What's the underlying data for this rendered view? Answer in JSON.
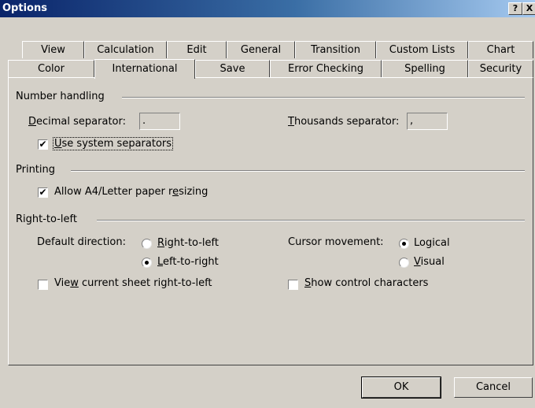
{
  "window": {
    "title": "Options",
    "help_label": "?",
    "close_label": "X"
  },
  "tabs_row1": [
    {
      "label": "View"
    },
    {
      "label": "Calculation"
    },
    {
      "label": "Edit"
    },
    {
      "label": "General"
    },
    {
      "label": "Transition"
    },
    {
      "label": "Custom Lists"
    },
    {
      "label": "Chart"
    }
  ],
  "tabs_row2": [
    {
      "label": "Color"
    },
    {
      "label": "International"
    },
    {
      "label": "Save"
    },
    {
      "label": "Error Checking"
    },
    {
      "label": "Spelling"
    },
    {
      "label": "Security"
    }
  ],
  "active_tab": "International",
  "number_handling": {
    "title": "Number handling",
    "decimal_label_u": "D",
    "decimal_label_rest": "ecimal separator:",
    "decimal_value": ".",
    "thousands_label_u": "T",
    "thousands_label_rest": "housands separator:",
    "thousands_value": ",",
    "use_system_u": "U",
    "use_system_rest": "se system separators",
    "use_system_checked": "✔"
  },
  "printing": {
    "title": "Printing",
    "a4_pre": "Allow A4/Letter paper r",
    "a4_u": "e",
    "a4_post": "sizing",
    "a4_checked": "✔"
  },
  "rtl": {
    "title": "Right-to-left",
    "default_direction_label": "Default direction:",
    "rtl_option_u": "R",
    "rtl_option_rest": "ight-to-left",
    "ltr_option_u": "L",
    "ltr_option_rest": "eft-to-right",
    "cursor_label": "Cursor movement:",
    "logical_pre": "Lo",
    "logical_u": "g",
    "logical_post": "ical",
    "visual_u": "V",
    "visual_rest": "isual",
    "view_sheet_pre": "Vie",
    "view_sheet_u": "w",
    "view_sheet_post": " current sheet right-to-left",
    "show_control_u": "S",
    "show_control_rest": "how control characters"
  },
  "buttons": {
    "ok": "OK",
    "cancel": "Cancel"
  }
}
